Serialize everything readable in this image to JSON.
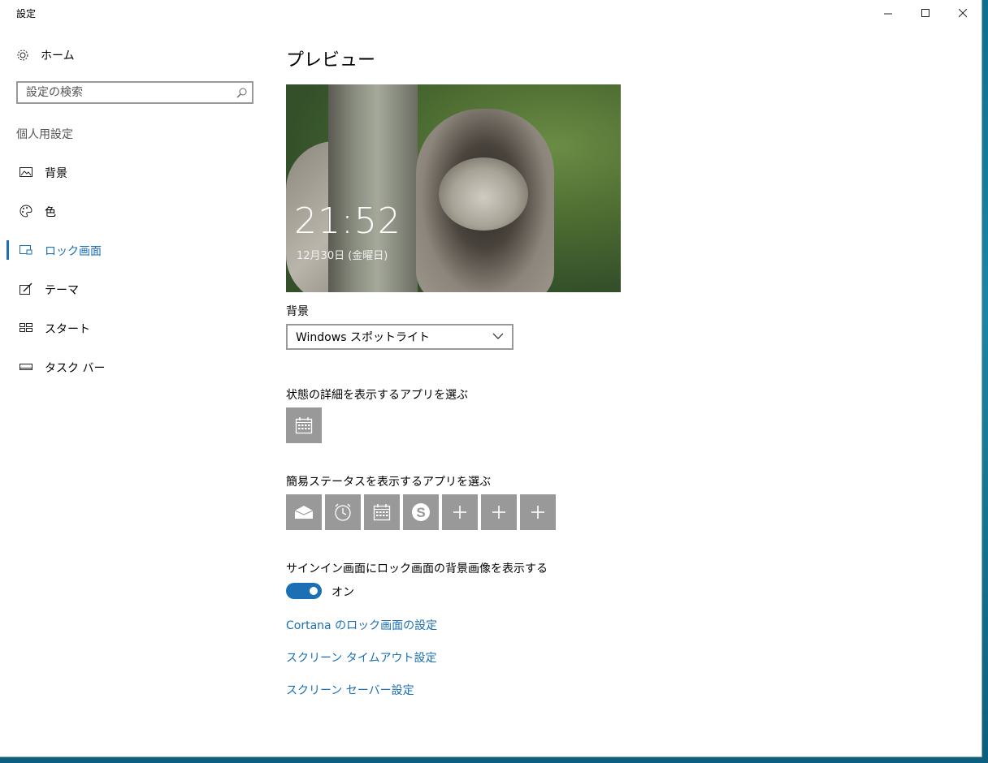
{
  "window": {
    "title": "設定",
    "controls": [
      "minimize-icon",
      "maximize-icon",
      "close-icon"
    ]
  },
  "sidebar": {
    "home_label": "ホーム",
    "search_placeholder": "設定の検索",
    "section_title": "個人用設定",
    "items": [
      {
        "label": "背景",
        "icon": "picture-icon"
      },
      {
        "label": "色",
        "icon": "palette-icon"
      },
      {
        "label": "ロック画面",
        "icon": "lock-screen-icon",
        "active": true
      },
      {
        "label": "テーマ",
        "icon": "theme-icon"
      },
      {
        "label": "スタート",
        "icon": "start-icon"
      },
      {
        "label": "タスク バー",
        "icon": "taskbar-icon"
      }
    ],
    "accent_color": "#1a6fb5"
  },
  "main": {
    "preview_heading": "プレビュー",
    "preview": {
      "time": "21:52",
      "date": "12月30日 (金曜日)"
    },
    "background_label": "背景",
    "background_value": "Windows スポットライト",
    "detailed_status_label": "状態の詳細を表示するアプリを選ぶ",
    "detailed_status_apps": [
      "calendar-icon"
    ],
    "quick_status_label": "簡易ステータスを表示するアプリを選ぶ",
    "quick_status_apps": [
      "mail-icon",
      "alarm-icon",
      "calendar-icon",
      "skype-icon",
      "plus-icon",
      "plus-icon",
      "plus-icon"
    ],
    "signin_label": "サインイン画面にロック画面の背景画像を表示する",
    "signin_toggle": {
      "state": "オン",
      "on": true
    },
    "links": {
      "cortana": "Cortana のロック画面の設定",
      "timeout": "スクリーン タイムアウト設定",
      "screensaver": "スクリーン セーバー設定"
    }
  }
}
